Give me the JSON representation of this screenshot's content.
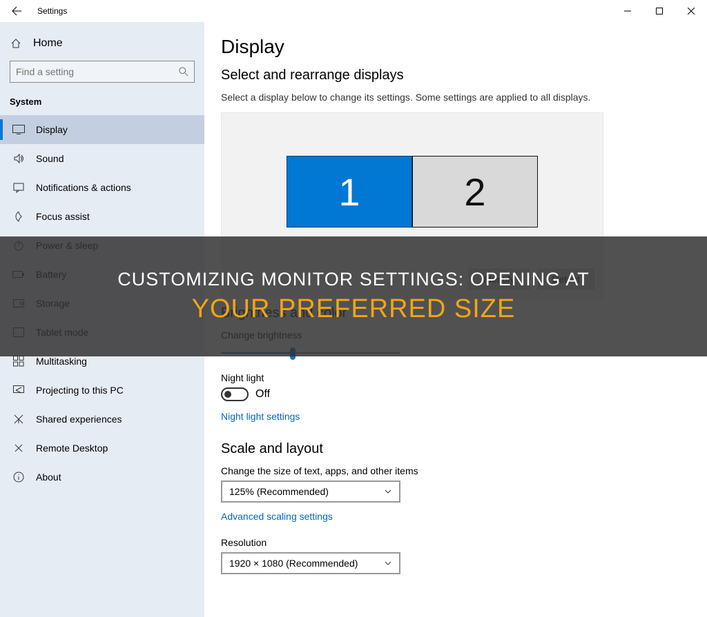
{
  "titlebar": {
    "title": "Settings"
  },
  "sidebar": {
    "home": "Home",
    "search_placeholder": "Find a setting",
    "section": "System",
    "items": [
      {
        "label": "Display"
      },
      {
        "label": "Sound"
      },
      {
        "label": "Notifications & actions"
      },
      {
        "label": "Focus assist"
      },
      {
        "label": "Power & sleep"
      },
      {
        "label": "Battery"
      },
      {
        "label": "Storage"
      },
      {
        "label": "Tablet mode"
      },
      {
        "label": "Multitasking"
      },
      {
        "label": "Projecting to this PC"
      },
      {
        "label": "Shared experiences"
      },
      {
        "label": "Remote Desktop"
      },
      {
        "label": "About"
      }
    ]
  },
  "main": {
    "page_title": "Display",
    "select_heading": "Select and rearrange displays",
    "select_body": "Select a display below to change its settings. Some settings are applied to all displays.",
    "monitor1": "1",
    "monitor2": "2",
    "identify": "Identify",
    "detect": "Detect",
    "brightness_heading": "Brightness and color",
    "brightness_label": "Change brightness",
    "night_light_label": "Night light",
    "night_light_state": "Off",
    "night_light_link": "Night light settings",
    "scale_heading": "Scale and layout",
    "scale_label": "Change the size of text, apps, and other items",
    "scale_value": "125% (Recommended)",
    "advanced_scaling": "Advanced scaling settings",
    "resolution_label": "Resolution",
    "resolution_value": "1920 × 1080 (Recommended)"
  },
  "overlay": {
    "line1": "CUSTOMIZING MONITOR SETTINGS: OPENING AT",
    "line2": "YOUR PREFERRED SIZE"
  }
}
